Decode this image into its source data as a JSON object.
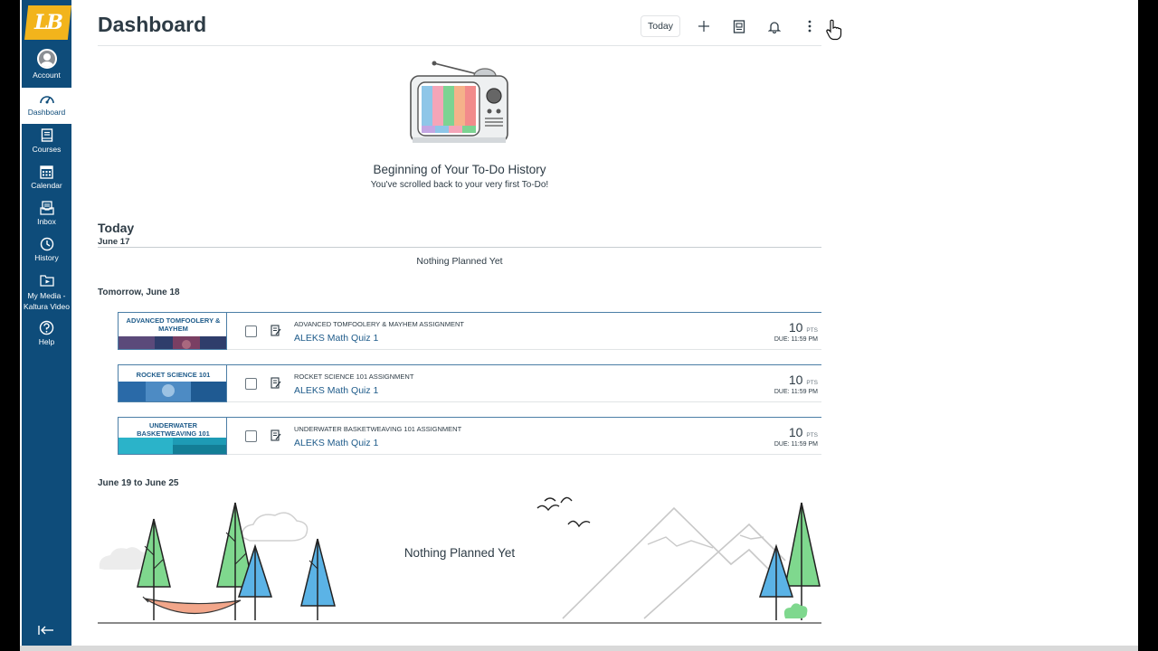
{
  "app": {
    "logo_text": "LB",
    "brand_color": "#f2b41c",
    "nav_color": "#0e4c7a",
    "link_color": "#1e5b8a"
  },
  "sidebar": {
    "items": [
      {
        "label": "Account",
        "icon": "avatar"
      },
      {
        "label": "Dashboard",
        "icon": "dashboard-icon"
      },
      {
        "label": "Courses",
        "icon": "courses-icon"
      },
      {
        "label": "Calendar",
        "icon": "calendar-icon"
      },
      {
        "label": "Inbox",
        "icon": "inbox-icon"
      },
      {
        "label": "History",
        "icon": "history-icon"
      },
      {
        "label": "My Media - Kaltura Video",
        "label_line1": "My Media -",
        "label_line2": "Kaltura Video",
        "icon": "media-icon"
      },
      {
        "label": "Help",
        "icon": "help-icon"
      }
    ],
    "collapse_icon": "collapse-icon"
  },
  "header": {
    "title": "Dashboard",
    "today_label": "Today",
    "icons": [
      "plus-icon",
      "list-icon",
      "bell-icon",
      "more-vertical-icon"
    ]
  },
  "history": {
    "title": "Beginning of Your To-Do History",
    "subtitle": "You've scrolled back to your very first To-Do!"
  },
  "today": {
    "heading": "Today",
    "date": "June 17",
    "nothing": "Nothing Planned Yet"
  },
  "tomorrow": {
    "heading": "Tomorrow, June 18",
    "items": [
      {
        "badge": "ADVANCED TOMFOOLERY & MAYHEM",
        "course": "ADVANCED TOMFOOLERY & MAYHEM ASSIGNMENT",
        "title": "ALEKS Math Quiz 1",
        "pts": "10",
        "pts_unit": "PTS",
        "due": "DUE: 11:59 PM"
      },
      {
        "badge": "ROCKET SCIENCE 101",
        "course": "ROCKET SCIENCE 101 ASSIGNMENT",
        "title": "ALEKS Math Quiz 1",
        "pts": "10",
        "pts_unit": "PTS",
        "due": "DUE: 11:59 PM"
      },
      {
        "badge": "UNDERWATER BASKETWEAVING 101",
        "course": "UNDERWATER BASKETWEAVING 101 ASSIGNMENT",
        "title": "ALEKS Math Quiz 1",
        "pts": "10",
        "pts_unit": "PTS",
        "due": "DUE: 11:59 PM"
      }
    ]
  },
  "week": {
    "heading": "June 19 to June 25",
    "nothing": "Nothing Planned Yet"
  }
}
